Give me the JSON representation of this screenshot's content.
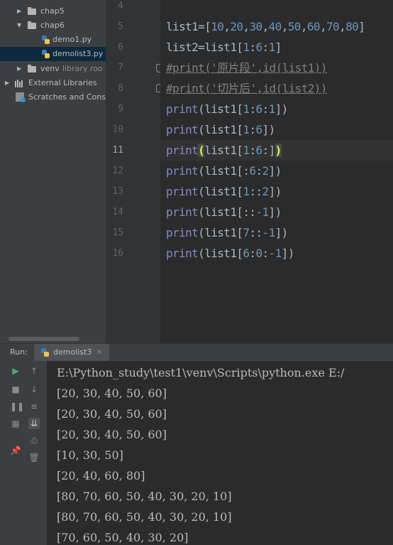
{
  "project_tree": {
    "items": [
      {
        "label": "chap5",
        "type": "folder",
        "expanded": false
      },
      {
        "label": "chap6",
        "type": "folder",
        "expanded": true
      },
      {
        "label": "demo1.py",
        "type": "python-file"
      },
      {
        "label": "demolist3.py",
        "type": "python-file",
        "selected": true
      },
      {
        "label": "venv",
        "suffix": "library roo",
        "type": "folder",
        "expanded": false
      },
      {
        "label": "External Libraries",
        "type": "libraries",
        "expanded": false
      },
      {
        "label": "Scratches and Cons",
        "type": "scratches"
      }
    ]
  },
  "gutter": {
    "line_numbers": [
      "4",
      "5",
      "6",
      "7",
      "8",
      "9",
      "10",
      "11",
      "12",
      "13",
      "14",
      "15",
      "16"
    ],
    "current_line": "11"
  },
  "editor": {
    "lines": [
      {
        "no": "4",
        "code": ""
      },
      {
        "no": "5",
        "code": "list1=[10,20,30,40,50,60,70,80]"
      },
      {
        "no": "6",
        "code": "list2=list1[1:6:1]"
      },
      {
        "no": "7",
        "code": "#print('原片段',id(list1))"
      },
      {
        "no": "8",
        "code": "#print('切片后',id(list2))"
      },
      {
        "no": "9",
        "code": "print(list1[1:6:1])"
      },
      {
        "no": "10",
        "code": "print(list1[1:6])"
      },
      {
        "no": "11",
        "code": "print(list1[1:6:])"
      },
      {
        "no": "12",
        "code": "print(list1[:6:2])"
      },
      {
        "no": "13",
        "code": "print(list1[1::2])"
      },
      {
        "no": "14",
        "code": "print(list1[::-1])"
      },
      {
        "no": "15",
        "code": "print(list1[7::-1])"
      },
      {
        "no": "16",
        "code": "print(list1[6:0:-1])"
      }
    ]
  },
  "run_panel": {
    "label": "Run:",
    "tab_label": "demolist3",
    "tab_close": "×",
    "toolbar_icons": [
      "run-icon",
      "up-icon",
      "stop-icon",
      "down-icon",
      "pause-icon",
      "soft-wrap-icon",
      "layout-icon",
      "scroll-to-end-icon",
      "pin-icon",
      "print-icon",
      "delete-icon"
    ],
    "output": [
      "E:\\Python_study\\test1\\venv\\Scripts\\python.exe E:/",
      "[20, 30, 40, 50, 60]",
      "[20, 30, 40, 50, 60]",
      "[20, 30, 40, 50, 60]",
      "[10, 30, 50]",
      "[20, 40, 60, 80]",
      "[80, 70, 60, 50, 40, 30, 20, 10]",
      "[80, 70, 60, 50, 40, 30, 20, 10]",
      "[70, 60, 50, 40, 30, 20]"
    ]
  },
  "colors": {
    "editor_bg": "#2b2b2b",
    "panel_bg": "#3c3f41",
    "keyword": "#8888c6",
    "number": "#6897bb",
    "comment": "#808080",
    "brace_highlight": "#ffef28"
  }
}
